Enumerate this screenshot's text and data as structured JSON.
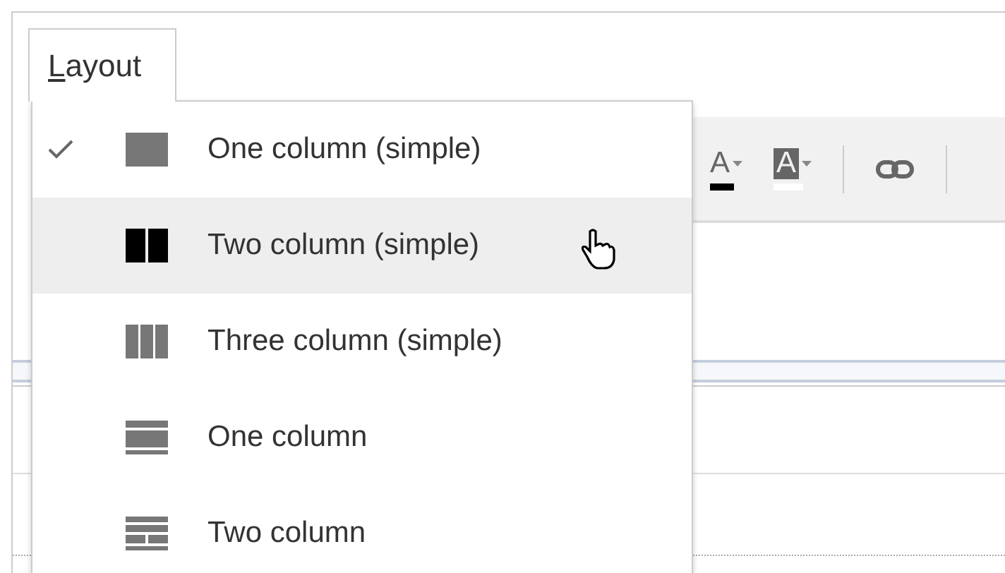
{
  "menu_tab": {
    "label": "Layout",
    "expanded": true
  },
  "menu": {
    "items": [
      {
        "label": "One column (simple)",
        "checked": true,
        "hovered": false,
        "kind": "one-simple"
      },
      {
        "label": "Two column (simple)",
        "checked": false,
        "hovered": true,
        "kind": "two-simple"
      },
      {
        "label": "Three column (simple)",
        "checked": false,
        "hovered": false,
        "kind": "three-simple"
      },
      {
        "label": "One column",
        "checked": false,
        "hovered": false,
        "kind": "one"
      },
      {
        "label": "Two column",
        "checked": false,
        "hovered": false,
        "kind": "two"
      }
    ]
  },
  "toolbar": {
    "items": [
      {
        "kind": "text-color",
        "glyph": "A",
        "color": "#000000"
      },
      {
        "kind": "highlight",
        "glyph": "A",
        "color": "#ffffff"
      },
      {
        "kind": "link"
      }
    ]
  }
}
